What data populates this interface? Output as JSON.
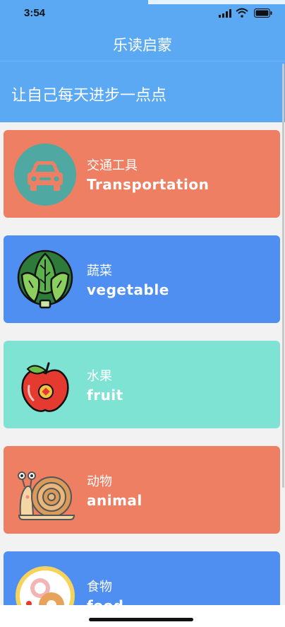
{
  "status_bar": {
    "time": "3:54"
  },
  "nav": {
    "title": "乐读启蒙"
  },
  "banner": {
    "text": "让自己每天进步一点点"
  },
  "categories": [
    {
      "cn": "交通工具",
      "en": "Transportation",
      "color": "#ee7f63",
      "icon": "car-icon"
    },
    {
      "cn": "蔬菜",
      "en": "vegetable",
      "color": "#4f8ff2",
      "icon": "cabbage-icon"
    },
    {
      "cn": "水果",
      "en": "fruit",
      "color": "#7fe3d3",
      "icon": "apple-icon"
    },
    {
      "cn": "动物",
      "en": "animal",
      "color": "#ee7f63",
      "icon": "snail-icon"
    },
    {
      "cn": "食物",
      "en": "food",
      "color": "#4f8ff2",
      "icon": "donut-icon"
    }
  ]
}
